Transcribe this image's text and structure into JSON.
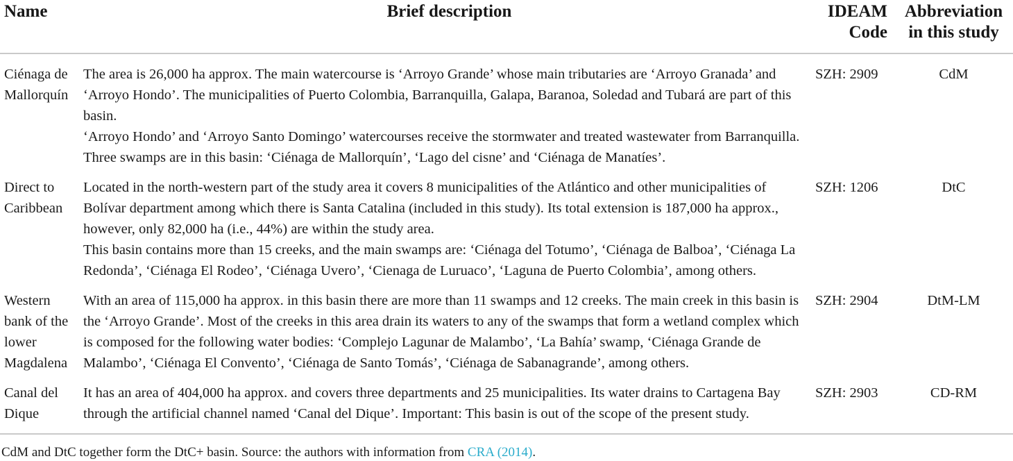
{
  "table": {
    "headers": {
      "name": "Name",
      "description": "Brief description",
      "code_line1": "IDEAM",
      "code_line2": "Code",
      "abbr_line1": "Abbreviation",
      "abbr_line2": "in this study"
    },
    "rows": [
      {
        "name": "Ciénaga de Mallorquín",
        "description_paragraphs": [
          "The area is 26,000 ha approx. The main watercourse is ‘Arroyo Grande’ whose main tributaries are ‘Arroyo Granada’ and ‘Arroyo Hondo’. The municipalities of Puerto Colombia, Barranquilla, Galapa, Baranoa, Soledad and Tubará are part of this basin.",
          "‘Arroyo Hondo’ and ‘Arroyo Santo Domingo’ watercourses receive the stormwater and treated wastewater from Barranquilla. Three swamps are in this basin: ‘Ciénaga de Mallorquín’, ‘Lago del cisne’ and ‘Ciénaga de Manatíes’."
        ],
        "ideam_code": "SZH: 2909",
        "abbreviation": "CdM"
      },
      {
        "name": "Direct to Caribbean",
        "description_paragraphs": [
          "Located in the north-western part of the study area it covers 8 municipalities of the Atlántico and other municipalities of Bolívar department among which there is Santa Catalina (included in this study). Its total extension is 187,000 ha approx., however, only 82,000 ha (i.e., 44%) are within the study area.",
          "This basin contains more than 15 creeks, and the main swamps are: ‘Ciénaga del Totumo’, ‘Ciénaga de Balboa’, ‘Ciénaga La Redonda’, ‘Ciénaga El Rodeo’, ‘Ciénaga Uvero’, ‘Cienaga de Luruaco’, ‘Laguna de Puerto Colombia’, among others."
        ],
        "ideam_code": "SZH: 1206",
        "abbreviation": "DtC"
      },
      {
        "name": "Western bank of the lower Magdalena",
        "description_paragraphs": [
          "With an area of 115,000 ha approx. in this basin there are more than 11 swamps and 12 creeks. The main creek in this basin is the ‘Arroyo Grande’. Most of the creeks in this area drain its waters to any of the swamps that form a wetland complex which is composed for the following water bodies: ‘Complejo Lagunar de Malambo’, ‘La Bahía’ swamp, ‘Ciénaga Grande de Malambo’, ‘Ciénaga El Convento’, ‘Ciénaga de Santo Tomás’, ‘Ciénaga de Sabanagrande’, among others."
        ],
        "ideam_code": "SZH: 2904",
        "abbreviation": "DtM-LM"
      },
      {
        "name": "Canal del Dique",
        "description_paragraphs": [
          "It has an area of 404,000 ha approx. and covers three departments and 25 municipalities. Its water drains to Cartagena Bay through the artificial channel named ‘Canal del Dique’. Important: This basin is out of the scope of the present study."
        ],
        "ideam_code": "SZH: 2903",
        "abbreviation": "CD-RM"
      }
    ]
  },
  "footnote": {
    "text_before_link": "CdM and DtC together form the DtC+ basin. Source: the authors with information from ",
    "link_text": "CRA (2014)",
    "text_after_link": ".",
    "link_color": "#2aaccb"
  }
}
